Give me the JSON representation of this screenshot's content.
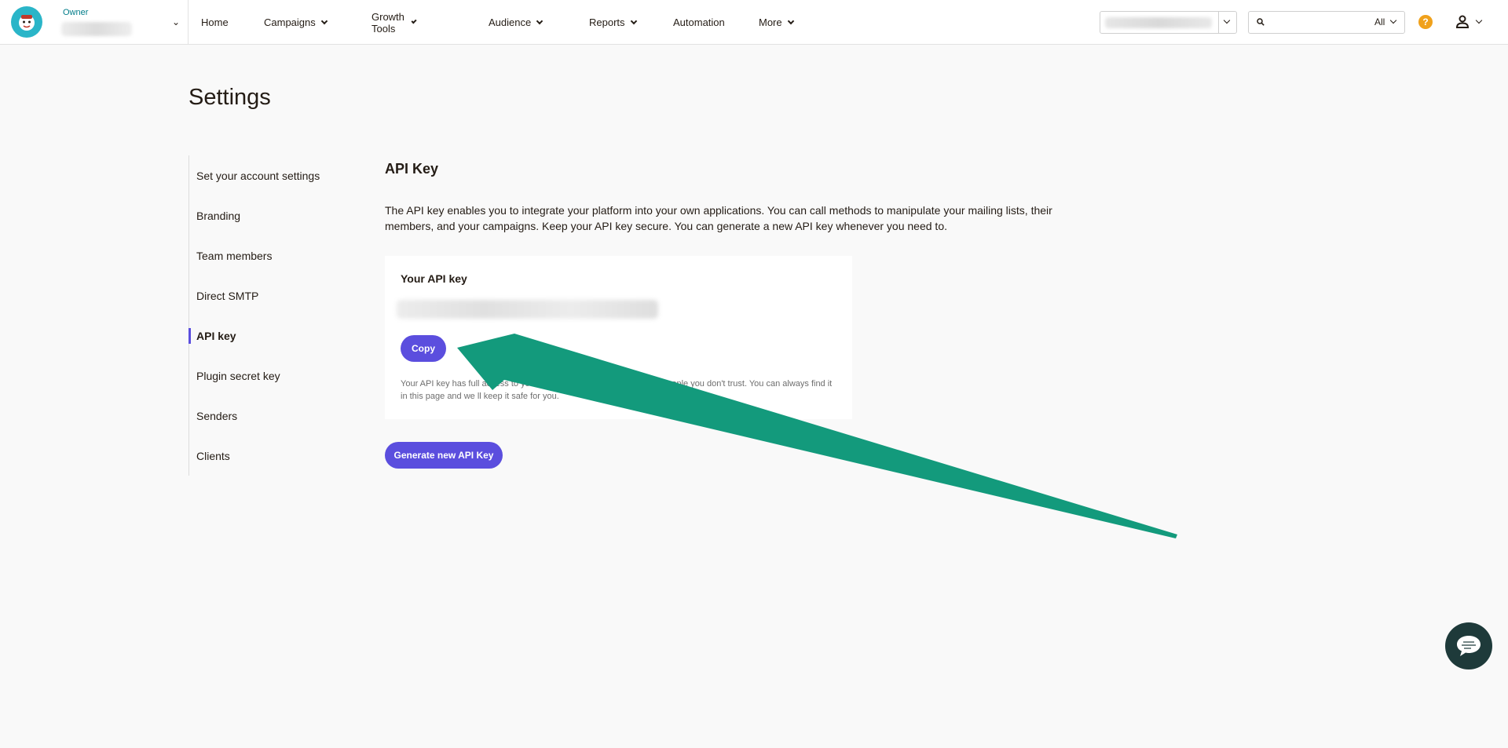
{
  "topbar": {
    "account": {
      "role_label": "Owner"
    },
    "nav": [
      {
        "label": "Home",
        "has_dropdown": false
      },
      {
        "label": "Campaigns",
        "has_dropdown": true
      },
      {
        "label": "Growth Tools",
        "has_dropdown": true
      },
      {
        "label": "Audience",
        "has_dropdown": true
      },
      {
        "label": "Reports",
        "has_dropdown": true
      },
      {
        "label": "Automation",
        "has_dropdown": false
      },
      {
        "label": "More",
        "has_dropdown": true
      }
    ],
    "search": {
      "placeholder": "",
      "scope": "All"
    },
    "help_icon": "?",
    "icons": [
      "logo-icon",
      "search-icon",
      "help-icon",
      "user-icon",
      "chat-icon"
    ]
  },
  "page": {
    "title": "Settings"
  },
  "sidebar": {
    "items": [
      {
        "label": "Set your account settings",
        "active": false
      },
      {
        "label": "Branding",
        "active": false
      },
      {
        "label": "Team members",
        "active": false
      },
      {
        "label": "Direct SMTP",
        "active": false
      },
      {
        "label": "API key",
        "active": true
      },
      {
        "label": "Plugin secret key",
        "active": false
      },
      {
        "label": "Senders",
        "active": false
      },
      {
        "label": "Clients",
        "active": false
      }
    ]
  },
  "main": {
    "section_title": "API Key",
    "description": "The API key enables you to integrate your platform into your own applications. You can call methods to manipulate your mailing lists, their members, and your campaigns. Keep your API key secure. You can generate a new API key whenever you need to.",
    "card": {
      "title": "Your API key",
      "copy_label": "Copy",
      "note": "Your API key has full access to your account, don't give this away to people you don't trust. You can always find it in this page and we ll keep it safe for you."
    },
    "generate_label": "Generate new API Key"
  },
  "colors": {
    "accent": "#5b4ede",
    "arrow": "#139a7c",
    "help": "#f0a11b",
    "logo_bg": "#2ab5c8",
    "chat_bg": "#1e3a3a"
  }
}
